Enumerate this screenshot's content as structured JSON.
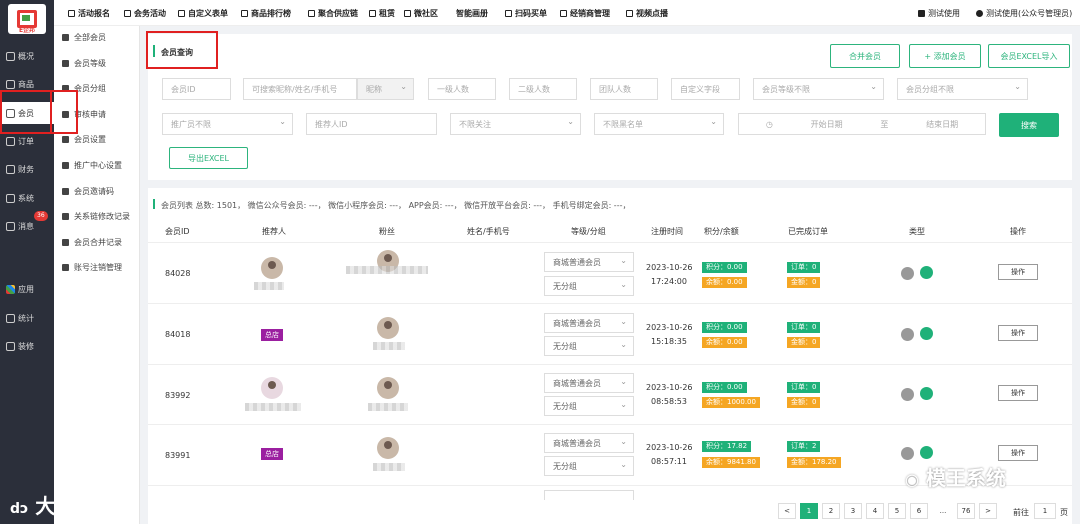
{
  "logo_text": "E企邦",
  "top_menu": [
    "活动报名",
    "会务活动",
    "自定义表单",
    "商品排行榜",
    "聚合供应链",
    "租赁",
    "微社区",
    "智能画册",
    "扫码买单",
    "经销商管理",
    "视频点播"
  ],
  "top_right": {
    "trial": "测试使用",
    "user": "测试使用(公众号管理员)"
  },
  "side_nav": [
    {
      "label": "概况"
    },
    {
      "label": "商品"
    },
    {
      "label": "会员"
    },
    {
      "label": "订单"
    },
    {
      "label": "财务"
    },
    {
      "label": "系统"
    },
    {
      "label": "消息"
    }
  ],
  "msg_badge": "36",
  "side_nav_bottom": [
    {
      "label": "应用"
    },
    {
      "label": "统计"
    },
    {
      "label": "装修"
    }
  ],
  "sub_menu": [
    "全部会员",
    "会员等级",
    "会员分组",
    "审核申请",
    "会员设置",
    "推广中心设置",
    "会员邀请码",
    "关系链修改记录",
    "会员合并记录",
    "账号注销管理"
  ],
  "section_title": "会员查询",
  "actions": {
    "merge": "合并会员",
    "add": "+ 添加会员",
    "import": "会员EXCEL导入"
  },
  "filters": {
    "member_id": "会员ID",
    "search_ph": "可搜索昵称/姓名/手机号",
    "nickname": "昵称",
    "level1": "一级人数",
    "level2": "二级人数",
    "team": "团队人数",
    "custom": "自定义字段",
    "grade": "会员等级不限",
    "group": "会员分组不限",
    "promoter": "推广员不限",
    "referrer": "推荐人ID",
    "follow": "不限关注",
    "blacklist": "不限黑名单",
    "start": "开始日期",
    "to": "至",
    "end": "结束日期",
    "search_btn": "搜索",
    "export": "导出EXCEL"
  },
  "list_summary": "会员列表 总数: 1501， 微信公众号会员: ---， 微信小程序会员: ---， APP会员: ---， 微信开放平台会员: ---， 手机号绑定会员: ---，",
  "columns": [
    "会员ID",
    "推荐人",
    "粉丝",
    "姓名/手机号",
    "等级/分组",
    "注册时间",
    "积分/余额",
    "已完成订单",
    "类型",
    "操作"
  ],
  "rows": [
    {
      "id": "84028",
      "ref_tag": "",
      "grade": "商城普通会员",
      "group": "无分组",
      "date": "2023-10-26",
      "time": "17:24:00",
      "points": "积分：0.00",
      "balance": "余额：0.00",
      "orders": "订单：0",
      "amount": "金额：0",
      "op": "操作"
    },
    {
      "id": "84018",
      "ref_tag": "总店",
      "grade": "商城普通会员",
      "group": "无分组",
      "date": "2023-10-26",
      "time": "15:18:35",
      "points": "积分：0.00",
      "balance": "余额：0.00",
      "orders": "订单：0",
      "amount": "金额：0",
      "op": "操作"
    },
    {
      "id": "83992",
      "ref_tag": "",
      "grade": "商城普通会员",
      "group": "无分组",
      "date": "2023-10-26",
      "time": "08:58:53",
      "points": "积分：0.00",
      "balance": "余额：1000.00",
      "orders": "订单：0",
      "amount": "金额：0",
      "op": "操作"
    },
    {
      "id": "83991",
      "ref_tag": "总店",
      "grade": "商城普通会员",
      "group": "无分组",
      "date": "2023-10-26",
      "time": "08:57:11",
      "points": "积分：17.82",
      "balance": "余额：9841.80",
      "orders": "订单：2",
      "amount": "金额：178.20",
      "op": "操作"
    }
  ],
  "pagination": {
    "prev": "<",
    "pages": [
      "1",
      "2",
      "3",
      "4",
      "5",
      "6",
      "...",
      "76"
    ],
    "next": ">",
    "goto": "前往",
    "page_val": "1",
    "page_unit": "页"
  },
  "watermark_left": "大数跨境",
  "watermark_right": "模王系统"
}
